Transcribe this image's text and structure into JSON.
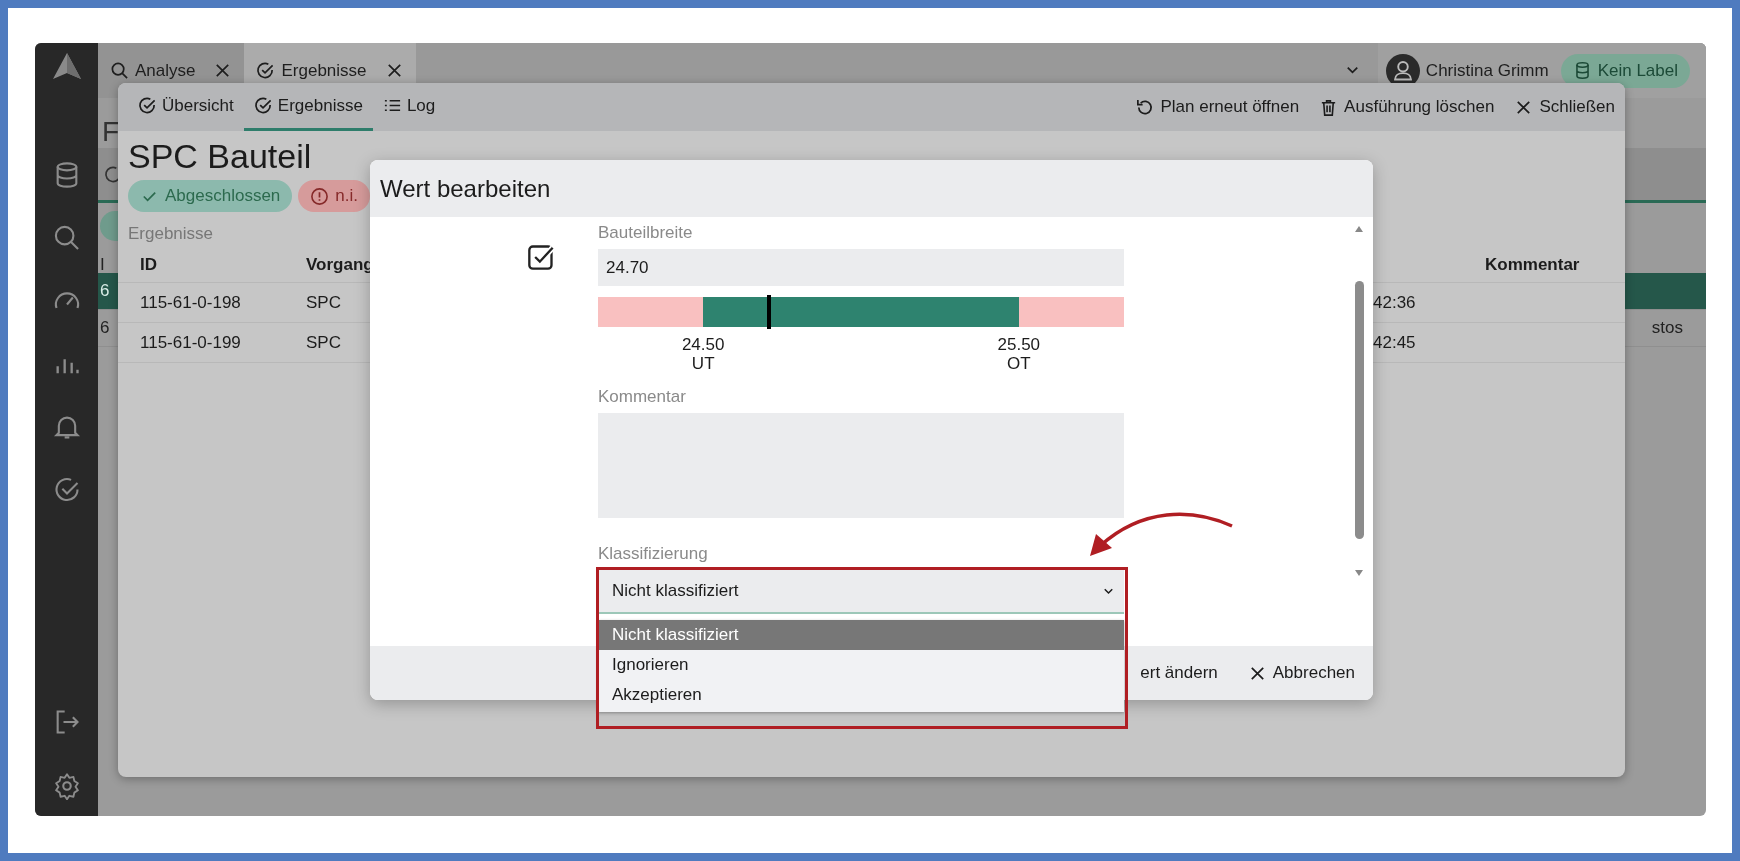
{
  "app": {
    "tabs": [
      {
        "label": "Analyse",
        "selected": false
      },
      {
        "label": "Ergebnisse",
        "selected": true
      }
    ],
    "user": "Christina Grimm",
    "label_chip": "Kein Label"
  },
  "background_page": {
    "heading_fragment": "F",
    "column_fragment": "I",
    "rows": [
      {
        "fragment": "6",
        "selected": true
      },
      {
        "fragment": "6",
        "selected": false,
        "cell_fragment": "stos"
      }
    ]
  },
  "panel": {
    "tabs": [
      {
        "label": "Übersicht",
        "selected": false
      },
      {
        "label": "Ergebnisse",
        "selected": true
      },
      {
        "label": "Log",
        "selected": false
      }
    ],
    "actions": [
      {
        "label": "Plan erneut öffnen"
      },
      {
        "label": "Ausführung löschen"
      },
      {
        "label": "Schließen"
      }
    ],
    "title": "SPC Bauteil",
    "badges": [
      {
        "label": "Abgeschlossen",
        "kind": "success"
      },
      {
        "label": "n.i.",
        "kind": "error"
      }
    ],
    "section_label": "Ergebnisse",
    "table": {
      "columns": [
        "ID",
        "Vorgang",
        "Kommentar"
      ],
      "rows": [
        {
          "id": "115-61-0-198",
          "process": "SPC",
          "time": "42:36"
        },
        {
          "id": "115-61-0-199",
          "process": "SPC",
          "time": "42:45"
        }
      ]
    }
  },
  "modal": {
    "title": "Wert bearbeiten",
    "field": {
      "label": "Bauteilbreite",
      "value": "24.70",
      "checked": true
    },
    "tolerance": {
      "level": 0.325,
      "lower": {
        "value": "24.50",
        "label": "UT"
      },
      "upper": {
        "value": "25.50",
        "label": "OT"
      }
    },
    "comment": {
      "label": "Kommentar"
    },
    "classification": {
      "label": "Klassifizierung",
      "value": "Nicht klassifiziert",
      "options": [
        {
          "label": "Nicht klassifiziert",
          "selected": true
        },
        {
          "label": "Ignorieren",
          "selected": false
        },
        {
          "label": "Akzeptieren",
          "selected": false
        }
      ]
    },
    "buttons": [
      {
        "label": "ert ändern"
      },
      {
        "label": "Abbrechen"
      }
    ]
  },
  "annotation": {
    "highlight_frame": true,
    "arrow": true
  }
}
